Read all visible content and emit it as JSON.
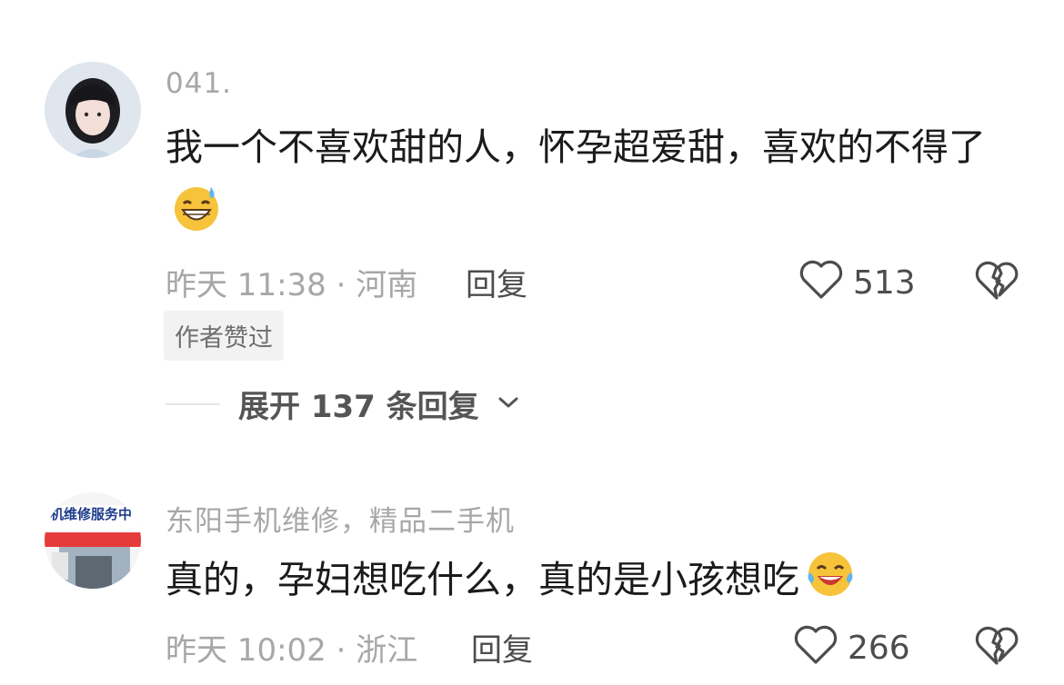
{
  "comments": [
    {
      "username": "041.",
      "text": "我一个不喜欢甜的人，怀孕超爱甜，喜欢的不得了",
      "emoji_icon": "grinning-sweat-emoji",
      "time_location": "昨天 11:38 · 河南",
      "reply_label": "回复",
      "likes": "513",
      "badge": "作者赞过",
      "expand_label": "展开 137 条回复"
    },
    {
      "username": "东阳手机维修，精品二手机",
      "text": "真的，孕妇想吃什么，真的是小孩想吃",
      "emoji_icon": "tears-of-joy-emoji",
      "avatar_sign": "机维修服务中",
      "time_location": "昨天 10:02 · 浙江",
      "reply_label": "回复",
      "likes": "266"
    }
  ],
  "colors": {
    "muted": "#a7a7a7",
    "text": "#1b1b1b",
    "action": "#4c4c4c"
  }
}
